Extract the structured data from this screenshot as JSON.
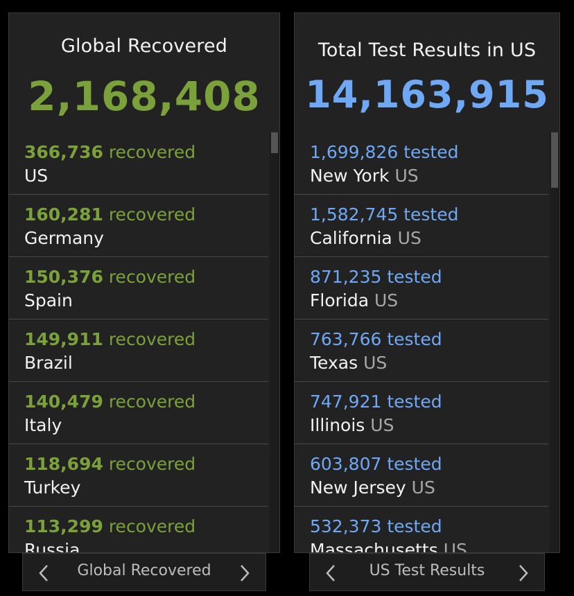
{
  "left_panel": {
    "title": "Global Recovered",
    "total": "2,168,408",
    "unit": "recovered",
    "items": [
      {
        "value": "366,736",
        "name": "US"
      },
      {
        "value": "160,281",
        "name": "Germany"
      },
      {
        "value": "150,376",
        "name": "Spain"
      },
      {
        "value": "149,911",
        "name": "Brazil"
      },
      {
        "value": "140,479",
        "name": "Italy"
      },
      {
        "value": "118,694",
        "name": "Turkey"
      },
      {
        "value": "113,299",
        "name": "Russia"
      }
    ],
    "pager_label": "Global Recovered"
  },
  "right_panel": {
    "title": "Total Test Results in US",
    "total": "14,163,915",
    "unit": "tested",
    "items": [
      {
        "value": "1,699,826",
        "name": "New York",
        "region": "US"
      },
      {
        "value": "1,582,745",
        "name": "California",
        "region": "US"
      },
      {
        "value": "871,235",
        "name": "Florida",
        "region": "US"
      },
      {
        "value": "763,766",
        "name": "Texas",
        "region": "US"
      },
      {
        "value": "747,921",
        "name": "Illinois",
        "region": "US"
      },
      {
        "value": "603,807",
        "name": "New Jersey",
        "region": "US"
      },
      {
        "value": "532,373",
        "name": "Massachusetts",
        "region": "US"
      }
    ],
    "pager_label": "US Test Results"
  },
  "colors": {
    "recovered_green": "#7ba23a",
    "tested_blue": "#6fa8f5",
    "panel_bg": "#222222"
  },
  "icons": {
    "prev": "chevron-left-icon",
    "next": "chevron-right-icon"
  }
}
